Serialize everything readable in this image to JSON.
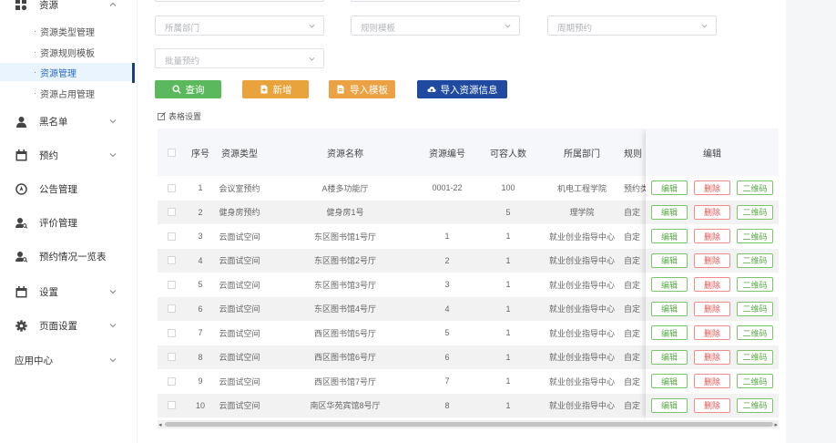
{
  "sidebar": {
    "groups": [
      {
        "label": "资源",
        "icon": "grid-icon"
      },
      {
        "label": "黑名单",
        "icon": "user-icon"
      },
      {
        "label": "预约",
        "icon": "calendar-icon"
      },
      {
        "label": "公告管理",
        "icon": "compass-icon"
      },
      {
        "label": "评价管理",
        "icon": "user-search-icon"
      },
      {
        "label": "预约情况一览表",
        "icon": "user-search-icon"
      },
      {
        "label": "设置",
        "icon": "calendar-icon"
      },
      {
        "label": "页面设置",
        "icon": "gear-icon"
      },
      {
        "label": "应用中心",
        "icon": ""
      }
    ],
    "sub_items": [
      {
        "label": "资源类型管理"
      },
      {
        "label": "资源规则模板"
      },
      {
        "label": "资源管理",
        "active": true
      },
      {
        "label": "资源占用管理"
      }
    ]
  },
  "filters": {
    "department_placeholder": "所属部门",
    "rule_template_placeholder": "规则模板",
    "cycle_reservation_placeholder": "周期预约",
    "batch_reservation_placeholder": "批量预约"
  },
  "toolbar": {
    "query_label": "查询",
    "add_label": "新增",
    "import_template_label": "导入模板",
    "import_resource_label": "导入资源信息",
    "table_settings_label": "表格设置"
  },
  "colors": {
    "query": "#5cb85c",
    "add": "#e8a33d",
    "import_template": "#eba245",
    "import_resource": "#1f4aa0",
    "active_nav": "#2d6cc2"
  },
  "table": {
    "headers": {
      "index": "序号",
      "type": "资源类型",
      "name": "资源名称",
      "code": "资源编号",
      "capacity": "可容人数",
      "department": "所属部门",
      "rule": "规则",
      "edit": "编辑"
    },
    "actions": {
      "edit": "编辑",
      "delete": "删除",
      "qrcode": "二维码"
    },
    "rows": [
      {
        "index": "1",
        "type": "会议室预约",
        "name": "A楼多功能厅",
        "code": "0001-22",
        "capacity": "100",
        "department": "机电工程学院",
        "rule": "预约类"
      },
      {
        "index": "2",
        "type": "健身房预约",
        "name": "健身房1号",
        "code": "",
        "capacity": "5",
        "department": "理学院",
        "rule": "自定"
      },
      {
        "index": "3",
        "type": "云面试空间",
        "name": "东区图书馆1号厅",
        "code": "1",
        "capacity": "1",
        "department": "就业创业指导中心",
        "rule": "自定"
      },
      {
        "index": "4",
        "type": "云面试空间",
        "name": "东区图书馆2号厅",
        "code": "2",
        "capacity": "1",
        "department": "就业创业指导中心",
        "rule": "自定"
      },
      {
        "index": "5",
        "type": "云面试空间",
        "name": "东区图书馆3号厅",
        "code": "3",
        "capacity": "1",
        "department": "就业创业指导中心",
        "rule": "自定"
      },
      {
        "index": "6",
        "type": "云面试空间",
        "name": "东区图书馆4号厅",
        "code": "4",
        "capacity": "1",
        "department": "就业创业指导中心",
        "rule": "自定"
      },
      {
        "index": "7",
        "type": "云面试空间",
        "name": "西区图书馆5号厅",
        "code": "5",
        "capacity": "1",
        "department": "就业创业指导中心",
        "rule": "自定"
      },
      {
        "index": "8",
        "type": "云面试空间",
        "name": "西区图书馆6号厅",
        "code": "6",
        "capacity": "1",
        "department": "就业创业指导中心",
        "rule": "自定"
      },
      {
        "index": "9",
        "type": "云面试空间",
        "name": "西区图书馆7号厅",
        "code": "7",
        "capacity": "1",
        "department": "就业创业指导中心",
        "rule": "自定"
      },
      {
        "index": "10",
        "type": "云面试空间",
        "name": "南区华苑宾馆8号厅",
        "code": "8",
        "capacity": "1",
        "department": "就业创业指导中心",
        "rule": "自定"
      }
    ]
  }
}
